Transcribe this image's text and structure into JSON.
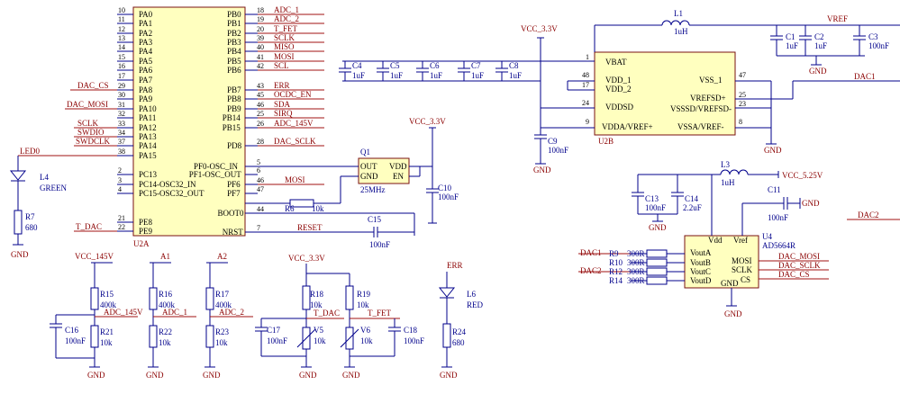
{
  "mcu": {
    "ref": "U2A",
    "left_pins": [
      {
        "num": "10",
        "name": "PA0"
      },
      {
        "num": "11",
        "name": "PA1"
      },
      {
        "num": "12",
        "name": "PA2"
      },
      {
        "num": "13",
        "name": "PA3"
      },
      {
        "num": "14",
        "name": "PA4"
      },
      {
        "num": "15",
        "name": "PA5"
      },
      {
        "num": "16",
        "name": "PA6"
      },
      {
        "num": "17",
        "name": "PA7"
      },
      {
        "num": "29",
        "name": "PA8"
      },
      {
        "num": "30",
        "name": "PA9"
      },
      {
        "num": "31",
        "name": "PA10"
      },
      {
        "num": "32",
        "name": "PA11"
      },
      {
        "num": "33",
        "name": "PA12"
      },
      {
        "num": "34",
        "name": "PA13"
      },
      {
        "num": "37",
        "name": "PA14"
      },
      {
        "num": "38",
        "name": "PA15"
      },
      {
        "num": "2",
        "name": "PC13"
      },
      {
        "num": "3",
        "name": "PC14-OSC32_IN"
      },
      {
        "num": "4",
        "name": "PC15-OSC32_OUT"
      },
      {
        "num": "21",
        "name": "PE8"
      },
      {
        "num": "22",
        "name": "PE9"
      }
    ],
    "right_pins": [
      {
        "num": "18",
        "name": "PB0",
        "net": "ADC_1"
      },
      {
        "num": "19",
        "name": "PB1",
        "net": "ADC_2"
      },
      {
        "num": "20",
        "name": "PB2",
        "net": "T_FET"
      },
      {
        "num": "39",
        "name": "PB3",
        "net": "SCLK"
      },
      {
        "num": "40",
        "name": "PB4",
        "net": "MISO"
      },
      {
        "num": "41",
        "name": "PB5",
        "net": "MOSI"
      },
      {
        "num": "42",
        "name": "PB6",
        "net": "SCL"
      },
      {
        "num": "43",
        "name": "PB7",
        "net": "ERR"
      },
      {
        "num": "45",
        "name": "PB8",
        "net": "OCDC_EN"
      },
      {
        "num": "46",
        "name": "PB9",
        "net": "SDA"
      },
      {
        "num": "25",
        "name": "PB14",
        "net": "SIRQ"
      },
      {
        "num": "26",
        "name": "PB15",
        "net": "ADC_145V"
      },
      {
        "num": "28",
        "name": "PD8",
        "net": "DAC_SCLK"
      },
      {
        "num": "5",
        "name": "PF0-OSC_IN",
        "net": ""
      },
      {
        "num": "6",
        "name": "PF1-OSC_OUT",
        "net": ""
      },
      {
        "num": "46",
        "name": "PF6",
        "net": "MOSI"
      },
      {
        "num": "47",
        "name": "PF7",
        "net": ""
      },
      {
        "num": "44",
        "name": "BOOT0",
        "net": ""
      },
      {
        "num": "7",
        "name": "NRST",
        "net": "RESET"
      }
    ],
    "left_nets": [
      "DAC_CS",
      "DAC_MOSI",
      "SCLK",
      "SWDIO",
      "SWDCLK",
      "LED0",
      "T_DAC"
    ]
  },
  "power_u2b": {
    "ref": "U2B",
    "pins": [
      {
        "num": "1",
        "name": "VBAT"
      },
      {
        "num": "48",
        "name": "VDD_1"
      },
      {
        "num": "17",
        "name": "VDD_2"
      },
      {
        "num": "24",
        "name": "VDDSD"
      },
      {
        "num": "9",
        "name": "VDDA/VREF+"
      },
      {
        "num": "47",
        "name": "VSS_1"
      },
      {
        "num": "25",
        "name": "VREFSD+"
      },
      {
        "num": "23",
        "name": "VSSSD/VREFSD-"
      },
      {
        "num": "8",
        "name": "VSSA/VREF-"
      }
    ],
    "caps": [
      {
        "ref": "C4",
        "val": "1uF"
      },
      {
        "ref": "C5",
        "val": "1uF"
      },
      {
        "ref": "C6",
        "val": "1uF"
      },
      {
        "ref": "C7",
        "val": "1uF"
      },
      {
        "ref": "C8",
        "val": "1uF"
      },
      {
        "ref": "C9",
        "val": "100nF"
      }
    ],
    "vcc": "VCC_3.3V",
    "gnd": "GND",
    "inductor": {
      "ref": "L1",
      "val": "1uH"
    },
    "vref": "VREF",
    "vref_caps": [
      {
        "ref": "C1",
        "val": "1uF"
      },
      {
        "ref": "C2",
        "val": "1uF"
      },
      {
        "ref": "C3",
        "val": "100nF"
      }
    ],
    "dac1_net": "DAC1"
  },
  "osc": {
    "ref": "Q1",
    "pins": [
      "OUT",
      "VDD",
      "GND",
      "EN"
    ],
    "freq": "25MHz",
    "vcc": "VCC_3.3V",
    "cap": {
      "ref": "C10",
      "val": "100nF"
    },
    "res": {
      "ref": "R6",
      "val": "10k"
    },
    "c15": {
      "ref": "C15",
      "val": "100nF"
    }
  },
  "led_green": {
    "net": "LED0",
    "ref": "L4",
    "color": "GREEN",
    "res": {
      "ref": "R7",
      "val": "680"
    },
    "gnd": "GND"
  },
  "dividers": [
    {
      "vcc": "VCC_145V",
      "r_top": {
        "ref": "R15",
        "val": "400k"
      },
      "r_bot": {
        "ref": "R21",
        "val": "10k"
      },
      "cap": {
        "ref": "C16",
        "val": "100nF"
      },
      "net": "ADC_145V"
    },
    {
      "vcc": "A1",
      "r_top": {
        "ref": "R16",
        "val": "400k"
      },
      "r_bot": {
        "ref": "R22",
        "val": "10k"
      },
      "net": "ADC_1"
    },
    {
      "vcc": "A2",
      "r_top": {
        "ref": "R17",
        "val": "400k"
      },
      "r_bot": {
        "ref": "R23",
        "val": "10k"
      },
      "net": "ADC_2"
    }
  ],
  "thermistors": {
    "vcc": "VCC_3.3V",
    "left": {
      "r": {
        "ref": "R18",
        "val": "10k"
      },
      "cap": {
        "ref": "C17",
        "val": "100nF"
      },
      "v": "V5",
      "vval": "10k",
      "net": "T_DAC"
    },
    "right": {
      "r": {
        "ref": "R19",
        "val": "10k"
      },
      "cap": {
        "ref": "C18",
        "val": "100nF"
      },
      "v": "V6",
      "vval": "10k",
      "net": "T_FET"
    }
  },
  "led_red": {
    "net": "ERR",
    "ref": "L6",
    "color": "RED",
    "res": {
      "ref": "R24",
      "val": "680"
    }
  },
  "dac": {
    "ref": "U4",
    "part": "AD5664R",
    "left_pins": [
      "VoutA",
      "VoutB",
      "VoutC",
      "VoutD"
    ],
    "top_pins": [
      "Vdd",
      "Vref"
    ],
    "right_pins": [
      "MOSI",
      "SCLK",
      "CS"
    ],
    "bottom_pin": "GND",
    "resistors": [
      {
        "ref": "R9",
        "val": "300R",
        "net": "DAC1"
      },
      {
        "ref": "R10",
        "val": "300R",
        "net": ""
      },
      {
        "ref": "R12",
        "val": "300R",
        "net": "DAC2"
      },
      {
        "ref": "R14",
        "val": "300R",
        "net": ""
      }
    ],
    "nets_right": [
      "DAC_MOSI",
      "DAC_SCLK",
      "DAC_CS"
    ],
    "inductor": {
      "ref": "L3",
      "val": "1uH"
    },
    "vcc": "VCC_5.25V",
    "caps": [
      {
        "ref": "C13",
        "val": "100nF"
      },
      {
        "ref": "C14",
        "val": "2.2uF"
      },
      {
        "ref": "C11",
        "val": "100nF"
      }
    ],
    "dac2_net": "DAC2"
  }
}
